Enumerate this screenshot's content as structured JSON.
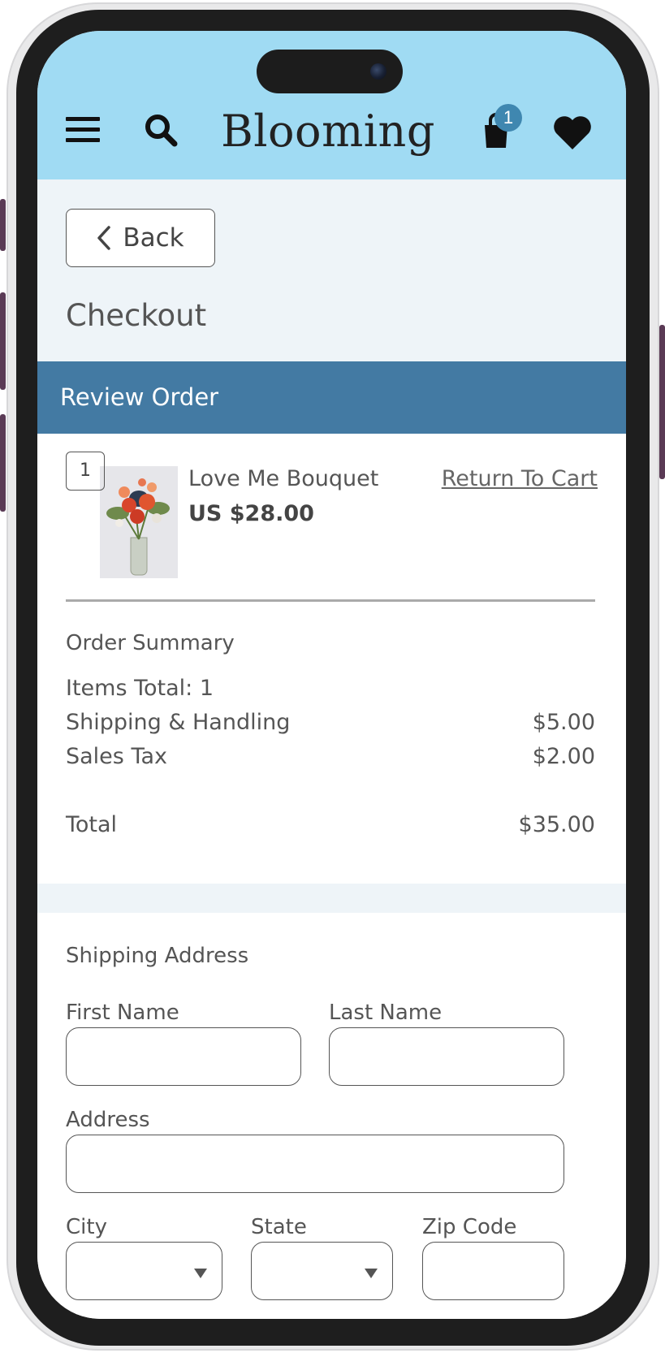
{
  "app": {
    "brand": "Blooming",
    "cart_count": "1"
  },
  "nav": {
    "back_label": "Back"
  },
  "page": {
    "title": "Checkout"
  },
  "review": {
    "section_title": "Review Order",
    "item": {
      "quantity": "1",
      "name": "Love Me Bouquet",
      "price": "US $28.00",
      "return_link": "Return To Cart"
    }
  },
  "summary": {
    "title": "Order Summary",
    "items_total": "Items Total: 1",
    "shipping_label": "Shipping & Handling",
    "shipping_value": "$5.00",
    "tax_label": "Sales Tax",
    "tax_value": "$2.00",
    "total_label": "Total",
    "total_value": "$35.00"
  },
  "shipping": {
    "title": "Shipping Address",
    "first_name_label": "First Name",
    "last_name_label": "Last Name",
    "address_label": "Address",
    "city_label": "City",
    "state_label": "State",
    "zip_label": "Zip Code"
  },
  "colors": {
    "header_bg": "#a0dbf3",
    "section_bar": "#437aa3",
    "badge": "#3f87b0",
    "light_band": "#eef4f8"
  }
}
